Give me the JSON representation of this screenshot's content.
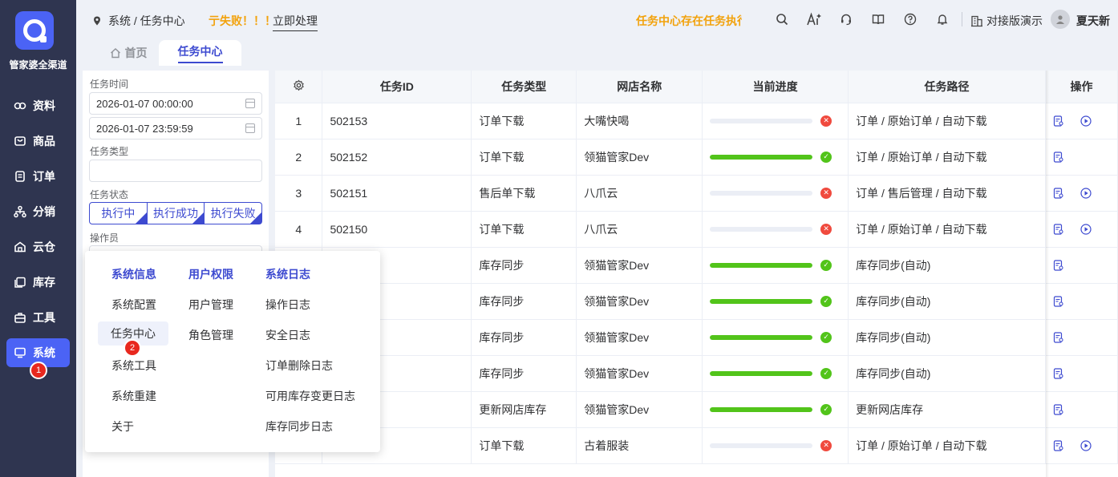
{
  "sidebar": {
    "brand": "管家婆全渠道",
    "items": [
      {
        "label": "资料",
        "icon": "database-icon"
      },
      {
        "label": "商品",
        "icon": "box-icon"
      },
      {
        "label": "订单",
        "icon": "document-icon"
      },
      {
        "label": "分销",
        "icon": "share-tree-icon"
      },
      {
        "label": "云仓",
        "icon": "warehouse-icon"
      },
      {
        "label": "库存",
        "icon": "stack-icon"
      },
      {
        "label": "工具",
        "icon": "toolbox-icon"
      },
      {
        "label": "系统",
        "icon": "monitor-icon"
      }
    ],
    "active": "系统",
    "badge": "1"
  },
  "header": {
    "breadcrumb": "系统 / 任务中心",
    "fail_text": "亍失败！！！",
    "fix_link": "立即处理",
    "notice": "任务中心存在任务执行",
    "demo_label": "对接版演示",
    "user_name": "夏天新"
  },
  "tabs": [
    {
      "label": "首页",
      "icon": "home-icon"
    },
    {
      "label": "任务中心"
    }
  ],
  "filter": {
    "time_label": "任务时间",
    "start_time": "2026-01-07 00:00:00",
    "end_time": "2026-01-07 23:59:59",
    "type_label": "任务类型",
    "type_value": "",
    "status_label": "任务状态",
    "status_options": [
      "执行中",
      "执行成功",
      "执行失败"
    ],
    "operator_label": "操作员"
  },
  "table": {
    "columns": [
      "",
      "任务ID",
      "任务类型",
      "网店名称",
      "当前进度",
      "任务路径",
      "操作"
    ],
    "rows": [
      {
        "no": "1",
        "id": "502153",
        "type": "订单下载",
        "shop": "大嘴快喝",
        "progress": 0,
        "ok": false,
        "path": "订单 / 原始订单 / 自动下载",
        "play": true
      },
      {
        "no": "2",
        "id": "502152",
        "type": "订单下载",
        "shop": "领猫管家Dev",
        "progress": 100,
        "ok": true,
        "path": "订单 / 原始订单 / 自动下载",
        "play": false
      },
      {
        "no": "3",
        "id": "502151",
        "type": "售后单下载",
        "shop": "八爪云",
        "progress": 0,
        "ok": false,
        "path": "订单 / 售后管理 / 自动下载",
        "play": true
      },
      {
        "no": "4",
        "id": "502150",
        "type": "订单下载",
        "shop": "八爪云",
        "progress": 0,
        "ok": false,
        "path": "订单 / 原始订单 / 自动下载",
        "play": true
      },
      {
        "no": "",
        "id": "",
        "type": "库存同步",
        "shop": "领猫管家Dev",
        "progress": 100,
        "ok": true,
        "path": "库存同步(自动)",
        "play": false
      },
      {
        "no": "",
        "id": "",
        "type": "库存同步",
        "shop": "领猫管家Dev",
        "progress": 100,
        "ok": true,
        "path": "库存同步(自动)",
        "play": false
      },
      {
        "no": "",
        "id": "",
        "type": "库存同步",
        "shop": "领猫管家Dev",
        "progress": 100,
        "ok": true,
        "path": "库存同步(自动)",
        "play": false
      },
      {
        "no": "",
        "id": "",
        "type": "库存同步",
        "shop": "领猫管家Dev",
        "progress": 100,
        "ok": true,
        "path": "库存同步(自动)",
        "play": false
      },
      {
        "no": "",
        "id": "",
        "type": "更新网店库存",
        "shop": "领猫管家Dev",
        "progress": 100,
        "ok": true,
        "path": "更新网店库存",
        "play": false
      },
      {
        "no": "",
        "id": "",
        "type": "订单下载",
        "shop": "古着服装",
        "progress": 0,
        "ok": false,
        "path": "订单 / 原始订单 / 自动下载",
        "play": true
      }
    ]
  },
  "menu": {
    "headers": [
      "系统信息",
      "用户权限",
      "系统日志"
    ],
    "col1": [
      "系统配置",
      "任务中心",
      "系统工具",
      "系统重建",
      "关于"
    ],
    "col2": [
      "用户管理",
      "角色管理"
    ],
    "col3": [
      "操作日志",
      "安全日志",
      "订单删除日志",
      "可用库存变更日志",
      "库存同步日志"
    ],
    "selected": "任务中心",
    "badge": "2"
  },
  "colors": {
    "accent": "#4b63f5",
    "sidebar": "#2f3550",
    "warning": "#f2a20c",
    "success": "#52c41a",
    "error": "#f04a3e"
  }
}
